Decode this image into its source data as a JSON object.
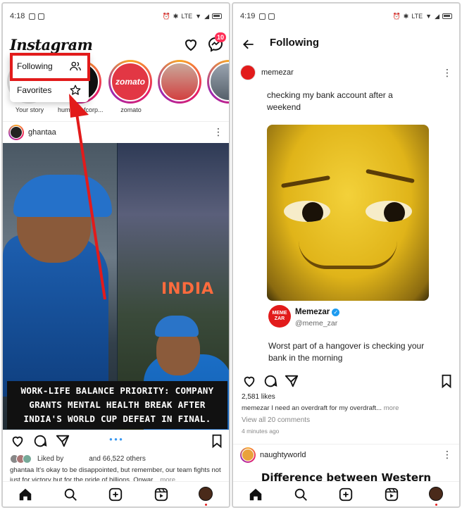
{
  "left": {
    "status": {
      "time": "4:18",
      "net": "LTE"
    },
    "header": {
      "logo": "Instagram",
      "caret": "⌄",
      "badge": "10"
    },
    "dropdown": {
      "following": "Following",
      "favorites": "Favorites"
    },
    "stories": [
      {
        "label": "Your story"
      },
      {
        "label": "humansofcorp..."
      },
      {
        "label": "zomato",
        "logo_text": "zomato"
      },
      {
        "label": ""
      },
      {
        "label": ""
      }
    ],
    "post": {
      "username": "ghantaa",
      "overlay_caption": "WORK-LIFE BALANCE PRIORITY: COMPANY GRANTS MENTAL HEALTH BREAK AFTER INDIA'S WORLD CUP DEFEAT IN FINAL.",
      "caption_line1": "WORK-LIFE BALANCE PRIORITY: COMPANY",
      "caption_line2": "GRANTS MENTAL HEALTH BREAK AFTER",
      "caption_line3": "INDIA'S WORLD CUP DEFEAT IN FINAL.",
      "jersey_text": "INDIA",
      "liked_by_prefix": "Liked by",
      "liked_by_suffix": "and 66,522 others",
      "caption": "ghantaa It's okay to be disappointed, but remember, our team fights not just for victory but for the pride of billions. Onwar...",
      "more": "more"
    }
  },
  "right": {
    "status": {
      "time": "4:19",
      "net": "LTE"
    },
    "header": {
      "title": "Following"
    },
    "post": {
      "username": "memezar",
      "text": "checking my bank account after a weekend",
      "tweet_name": "Memezar",
      "tweet_handle": "@meme_zar",
      "tweet_avatar_text": "MEME ZAR",
      "tweet_text": "Worst part of a hangover is checking your bank in the morning",
      "likes": "2,581 likes",
      "caption": "memezar I need an overdraft for my overdraft...",
      "more": "more",
      "comments": "View all 20 comments",
      "time_ago": "4 minutes ago"
    },
    "next_post": {
      "username": "naughtyworld",
      "teaser": "Difference between Western"
    }
  },
  "colors": {
    "highlight": "#e21b1b",
    "story_ring": "#e91e63",
    "link_blue": "#3897f0"
  },
  "icons": [
    "heart-icon",
    "messenger-icon",
    "people-icon",
    "star-icon",
    "comment-icon",
    "share-icon",
    "bookmark-icon",
    "home-icon",
    "search-icon",
    "add-icon",
    "reels-icon",
    "back-arrow-icon",
    "kebab-icon"
  ]
}
